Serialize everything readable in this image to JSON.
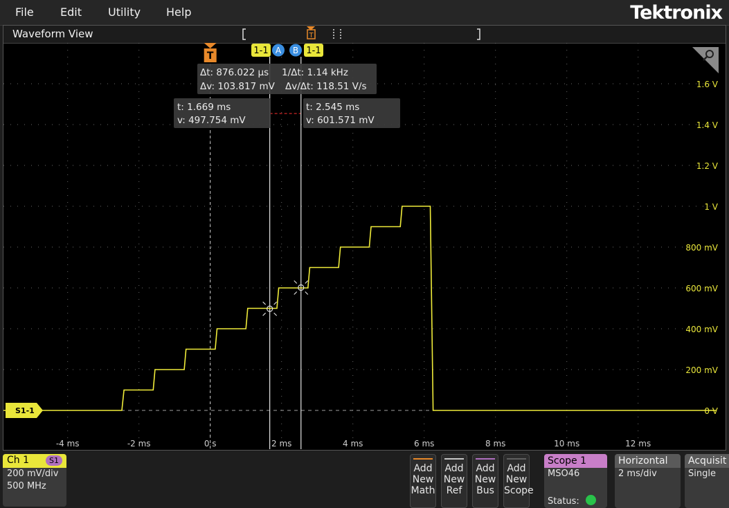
{
  "menu": {
    "file": "File",
    "edit": "Edit",
    "utility": "Utility",
    "help": "Help",
    "brand": "Tektronix"
  },
  "waveform_view": {
    "title": "Waveform View",
    "trigger_label": "T",
    "cursor_tags": [
      "1-1",
      "A",
      "B",
      "1-1"
    ],
    "channel_marker": "S1-1",
    "readouts": {
      "delta_t": "Δt: 876.022 µs",
      "delta_v": "Δv: 103.817 mV",
      "inv_delta_t": "1/Δt: 1.14 kHz",
      "dv_dt": "Δv/Δt: 118.51 V/s",
      "cursor_a_t": "t: 1.669 ms",
      "cursor_a_v": "v: 497.754 mV",
      "cursor_b_t": "t: 2.545 ms",
      "cursor_b_v": "v: 601.571 mV"
    }
  },
  "chart_data": {
    "type": "line",
    "x_ticks": [
      "-4 ms",
      "-2 ms",
      "0 s",
      "2 ms",
      "4 ms",
      "6 ms",
      "8 ms",
      "10 ms",
      "12 ms"
    ],
    "y_ticks": [
      "1.6 V",
      "1.4 V",
      "1.2 V",
      "1 V",
      "800 mV",
      "600 mV",
      "400 mV",
      "200 mV",
      "0 V"
    ],
    "xlim_ms": [
      -5.8,
      14.2
    ],
    "ylim_v": [
      -0.19,
      1.8
    ],
    "series": [
      {
        "color": "#f0ec3a",
        "x_ms": [
          -5.8,
          -2.48,
          -2.42,
          -1.6,
          -1.55,
          -0.73,
          -0.68,
          0.14,
          0.19,
          1.0,
          1.05,
          1.87,
          1.92,
          2.74,
          2.79,
          3.6,
          3.65,
          4.46,
          4.51,
          5.33,
          5.38,
          6.17,
          6.25,
          14.2
        ],
        "y_v": [
          0.0,
          0.0,
          0.1,
          0.1,
          0.2,
          0.2,
          0.3,
          0.3,
          0.4,
          0.4,
          0.5,
          0.5,
          0.6,
          0.6,
          0.7,
          0.7,
          0.8,
          0.8,
          0.9,
          0.9,
          1.0,
          1.0,
          0.0,
          0.0
        ]
      }
    ],
    "cursors": {
      "a_ms": 1.669,
      "b_ms": 2.545,
      "a_v": 0.497754,
      "b_v": 0.601571
    },
    "trigger_ms": 0.0,
    "grid": true
  },
  "channel": {
    "name": "Ch 1",
    "tag": "S1",
    "scale": "200 mV/div",
    "bandwidth": "500 MHz",
    "color": "#e9e63a"
  },
  "add_buttons": [
    {
      "l1": "Add",
      "l2": "New",
      "l3": "Math",
      "color": "#e8892a"
    },
    {
      "l1": "Add",
      "l2": "New",
      "l3": "Ref",
      "color": "#c8c8c8"
    },
    {
      "l1": "Add",
      "l2": "New",
      "l3": "Bus",
      "color": "#b070c0"
    },
    {
      "l1": "Add",
      "l2": "New",
      "l3": "Scope",
      "color": "#606060"
    }
  ],
  "scope": {
    "title": "Scope 1",
    "model": "MSO46",
    "status_label": "Status:",
    "color": "#c87ec8"
  },
  "horizontal": {
    "title": "Horizontal",
    "value": "2 ms/div"
  },
  "acquisition": {
    "title": "Acquisit",
    "value": "Single"
  }
}
